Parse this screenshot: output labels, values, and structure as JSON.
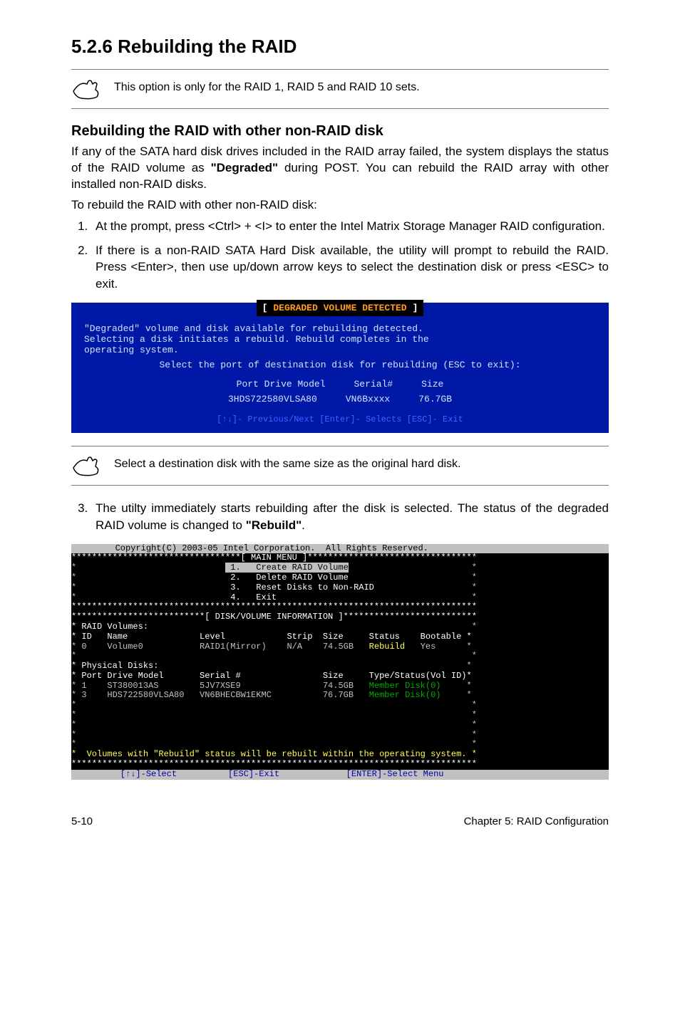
{
  "section": {
    "number": "5.2.6",
    "title": "Rebuilding the RAID"
  },
  "note1": "This option is only for the RAID 1, RAID 5 and RAID 10 sets.",
  "sub1": {
    "heading": "Rebuilding the RAID with other non-RAID disk",
    "p1": "If any of the SATA hard disk drives included in the RAID array failed, the system displays the status of the RAID volume as ",
    "p1_bold": "\"Degraded\"",
    "p1_after": " during POST. You can rebuild the RAID array with other installed non-RAID disks.",
    "p2": "To rebuild the RAID with other non-RAID disk:",
    "step1": "At the prompt, press <Ctrl> + <I> to enter the Intel Matrix Storage Manager RAID configuration.",
    "step2": "If there is a non-RAID SATA Hard Disk available, the utility will prompt to rebuild the RAID. Press <Enter>, then use up/down arrow keys to select the destination disk or press <ESC> to exit."
  },
  "blue_terminal": {
    "title_prefix": "[",
    "title_colored": "DEGRADED VOLUME DETECTED",
    "title_suffix": "]",
    "l1": "\"Degraded\" volume and disk available for rebuilding detected.",
    "l2": "Selecting a disk initiates a rebuild. Rebuild completes in the",
    "l3": "operating system.",
    "l4": "Select the port of destination disk for rebuilding (ESC to exit):",
    "hdr_port": "Port Drive Model",
    "hdr_serial": "Serial#",
    "hdr_size": "Size",
    "row_port": "3HDS722580VLSA80",
    "row_serial": "VN6Bxxxx",
    "row_size": "76.7GB",
    "hint": "[↑↓]- Previous/Next    [Enter]- Selects    [ESC]- Exit"
  },
  "note2": "Select a destination disk with the same size as the original hard disk.",
  "step3_p1": "The utilty immediately starts rebuilding after the disk is selected. The status of the degraded RAID volume is changed to ",
  "step3_bold": "\"Rebuild\"",
  "step3_after": ".",
  "bios": {
    "copyright": "        Copyright(C) 2003-05 Intel Corporation.  All Rights Reserved.         ",
    "stars_menu": "*********************************[ MAIN MENU ]*********************************",
    "menu1": " 1.   Create RAID Volume",
    "menu2": " 2.   Delete RAID Volume",
    "menu3": " 3.   Reset Disks to Non-RAID",
    "menu4": " 4.   Exit",
    "stars_full": "*******************************************************************************",
    "stars_info": "**************************[ DISK/VOLUME INFORMATION ]**************************",
    "vol_header": "* RAID Volumes:",
    "vol_cols": "* ID   Name              Level            Strip  Size     Status    Bootable *",
    "vol_row": "* 0    Volume0           RAID1(Mirror)    N/A    74.5GB   Rebuild   Yes      *",
    "phy_header": "* Physical Disks:",
    "phy_cols": "* Port Drive Model       Serial #                Size     Type/Status(Vol ID)*",
    "phy_row1": "* 1    ST380013AS        5JV7XSE9                74.5GB   Member Disk(0)     *",
    "phy_row2": "* 3    HDS722580VLSA80   VN6BHECBW1EKMC          76.7GB   Member Disk(0)     *",
    "warn": "*  Volumes with \"Rebuild\" status will be rebuilt within the operating system. *",
    "bottom": "         [↑↓]-Select          [ESC]-Exit             [ENTER]-Select Menu        "
  },
  "footer": {
    "left": "5-10",
    "right": "Chapter 5: RAID Configuration"
  }
}
